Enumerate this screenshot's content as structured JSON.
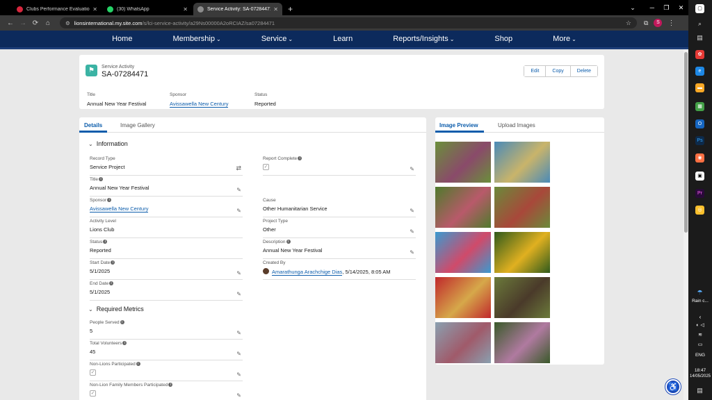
{
  "browser": {
    "tabs": [
      {
        "title": "Clubs Performance Evaluation S",
        "icon_color": "#d7263d",
        "active": false
      },
      {
        "title": "(30) WhatsApp",
        "icon_color": "#25d366",
        "active": false
      },
      {
        "title": "Service Activity: SA-07284471",
        "icon_color": "#8c8c8c",
        "active": true
      }
    ],
    "new_tab": "+",
    "url_host": "lionsinternational.my.site.com",
    "url_path": "/s/lci-service-activity/a29Ns00000A2oRCIAZ/sa07284471",
    "profile_initial": "S"
  },
  "sitenav": {
    "items": [
      {
        "label": "Home",
        "caret": false
      },
      {
        "label": "Membership",
        "caret": true
      },
      {
        "label": "Service",
        "caret": true
      },
      {
        "label": "Learn",
        "caret": false
      },
      {
        "label": "Reports/Insights",
        "caret": true
      },
      {
        "label": "Shop",
        "caret": false
      },
      {
        "label": "More",
        "caret": true
      }
    ]
  },
  "record": {
    "object_label": "Service Activity",
    "name": "SA-07284471",
    "actions": {
      "edit": "Edit",
      "copy": "Copy",
      "delete": "Delete"
    },
    "highlights": {
      "title_label": "Title",
      "title_value": "Annual New Year Festival",
      "sponsor_label": "Sponsor",
      "sponsor_value": "Avissawella New Century",
      "status_label": "Status",
      "status_value": "Reported"
    }
  },
  "detail_tabs": {
    "details": "Details",
    "gallery": "Image Gallery"
  },
  "information": {
    "heading": "Information",
    "record_type_label": "Record Type",
    "record_type": "Service Project",
    "title_label": "Title",
    "title": "Annual New Year Festival",
    "sponsor_label": "Sponsor",
    "sponsor": "Avissawella New Century",
    "activity_level_label": "Activity Level",
    "activity_level": "Lions Club",
    "status_label": "Status",
    "status": "Reported",
    "start_date_label": "Start Date",
    "start_date": "5/1/2025",
    "end_date_label": "End Date",
    "end_date": "5/1/2025",
    "report_complete_label": "Report Complete",
    "cause_label": "Cause",
    "cause": "Other Humanitarian Service",
    "project_type_label": "Project Type",
    "project_type": "Other",
    "description_label": "Description",
    "description": "Annual New Year Festival",
    "created_by_label": "Created By",
    "created_by": "Amarathunga Arachchige Dias",
    "created_on": ", 5/14/2025, 8:05 AM"
  },
  "metrics": {
    "heading": "Required Metrics",
    "people_served_label": "People Served",
    "people_served": "5",
    "total_volunteers_label": "Total Volunteers",
    "total_volunteers": "45",
    "non_lions_label": "Non-Lions Participated",
    "non_lion_family_label": "Non-Lion Family Members Participated"
  },
  "image_tabs": {
    "preview": "Image Preview",
    "upload": "Upload Images"
  },
  "images": [
    {
      "alt": "festival-photo-1",
      "c1": "#6a8f3a",
      "c2": "#8a4a6a"
    },
    {
      "alt": "festival-photo-2",
      "c1": "#4a8ab8",
      "c2": "#c9b46a"
    },
    {
      "alt": "festival-photo-3",
      "c1": "#4f7a2c",
      "c2": "#b85a6a"
    },
    {
      "alt": "festival-photo-4",
      "c1": "#6a8a3a",
      "c2": "#a8483a"
    },
    {
      "alt": "festival-photo-5",
      "c1": "#3a9ad0",
      "c2": "#d04a6a"
    },
    {
      "alt": "festival-photo-6",
      "c1": "#2f5a1c",
      "c2": "#e0b020"
    },
    {
      "alt": "festival-photo-7",
      "c1": "#c0282c",
      "c2": "#d6a84a"
    },
    {
      "alt": "festival-photo-8",
      "c1": "#6b7a3a",
      "c2": "#4a3a2a"
    },
    {
      "alt": "festival-photo-9",
      "c1": "#8aa0b0",
      "c2": "#a05a6a"
    },
    {
      "alt": "festival-photo-10",
      "c1": "#3a5a2a",
      "c2": "#b07aa0"
    }
  ],
  "taskbar": {
    "weather": "Rain c...",
    "lang": "ENG",
    "time": "18:47",
    "date": "14/05/2025"
  }
}
